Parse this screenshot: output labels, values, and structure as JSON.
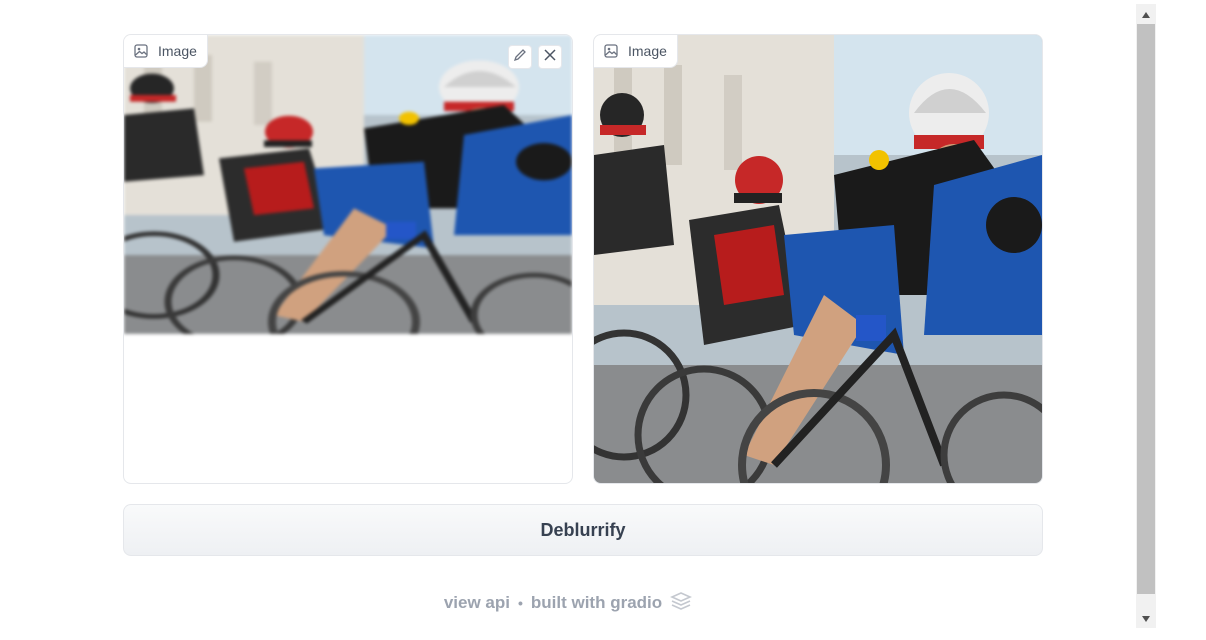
{
  "input_image": {
    "label": "Image",
    "icon": "image-icon",
    "edit_icon": "pencil-icon",
    "clear_icon": "close-icon"
  },
  "output_image": {
    "label": "Image",
    "icon": "image-icon"
  },
  "submit_button": {
    "label": "Deblurrify"
  },
  "footer": {
    "api_link": "view api",
    "separator": "•",
    "built_with": "built with gradio",
    "logo_icon": "gradio-logo-icon"
  },
  "colors": {
    "border": "#e5e7eb",
    "label_text": "#4b5563",
    "button_text": "#374151",
    "footer_text": "#9ca3af"
  }
}
